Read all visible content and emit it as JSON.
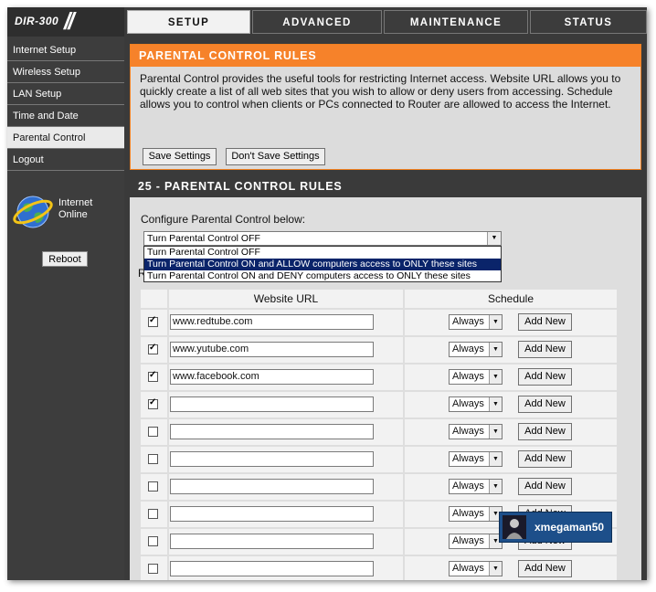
{
  "header": {
    "logo": "DIR-300",
    "tabs": [
      {
        "label": "SETUP",
        "active": true
      },
      {
        "label": "ADVANCED",
        "active": false
      },
      {
        "label": "MAINTENANCE",
        "active": false
      },
      {
        "label": "STATUS",
        "active": false
      }
    ]
  },
  "sidebar": {
    "items": [
      {
        "label": "Internet Setup",
        "active": false
      },
      {
        "label": "Wireless Setup",
        "active": false
      },
      {
        "label": "LAN Setup",
        "active": false
      },
      {
        "label": "Time and Date",
        "active": false
      },
      {
        "label": "Parental Control",
        "active": true
      },
      {
        "label": "Logout",
        "active": false
      }
    ],
    "status_line1": "Internet",
    "status_line2": "Online",
    "reboot_label": "Reboot"
  },
  "intro": {
    "title": "PARENTAL CONTROL RULES",
    "description": "Parental Control provides the useful tools for restricting Internet access. Website URL allows you to quickly create a list of all web sites that you wish to allow or deny users from accessing. Schedule allows you to control when clients or PCs connected to Router are allowed to access the Internet.",
    "save_label": "Save Settings",
    "dont_save_label": "Don't Save Settings"
  },
  "rules": {
    "title": "25 - PARENTAL CONTROL RULES",
    "configure_label": "Configure Parental Control below:",
    "select_value": "Turn Parental Control OFF",
    "options": [
      "Turn Parental Control OFF",
      "Turn Parental Control ON and ALLOW computers access to ONLY these sites",
      "Turn Parental Control ON and DENY computers access to ONLY these sites"
    ],
    "highlighted_option_index": 1,
    "obscured_label_letter": "R",
    "columns": {
      "url": "Website URL",
      "schedule": "Schedule"
    },
    "add_new_label": "Add New",
    "rows": [
      {
        "checked": true,
        "url": "www.redtube.com",
        "schedule": "Always"
      },
      {
        "checked": true,
        "url": "www.yutube.com",
        "schedule": "Always"
      },
      {
        "checked": true,
        "url": "www.facebook.com",
        "schedule": "Always"
      },
      {
        "checked": true,
        "url": "",
        "schedule": "Always"
      },
      {
        "checked": false,
        "url": "",
        "schedule": "Always"
      },
      {
        "checked": false,
        "url": "",
        "schedule": "Always"
      },
      {
        "checked": false,
        "url": "",
        "schedule": "Always"
      },
      {
        "checked": false,
        "url": "",
        "schedule": "Always"
      },
      {
        "checked": false,
        "url": "",
        "schedule": "Always"
      },
      {
        "checked": false,
        "url": "",
        "schedule": "Always"
      }
    ]
  },
  "watermark": {
    "text": "xmegaman50"
  },
  "colors": {
    "orange": "#f6822a",
    "dark": "#3a3a3a",
    "panel": "#dedede",
    "selected": "#0a246a"
  }
}
